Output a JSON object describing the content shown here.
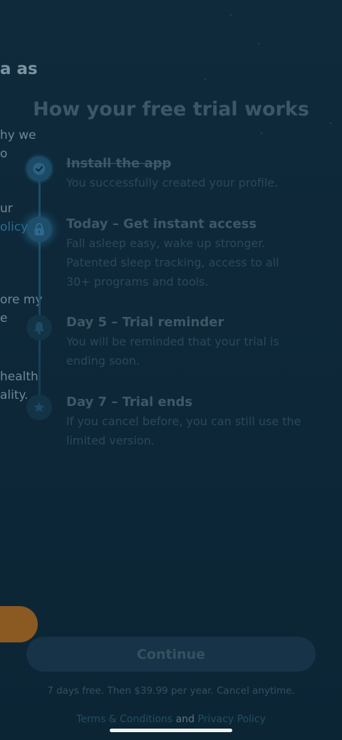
{
  "background_page": {
    "title_fragment": "a as",
    "lines": [
      "hy we",
      "o",
      "ur",
      "olicy",
      "ore my",
      "e",
      "health",
      "ality."
    ]
  },
  "heading": "How your free trial works",
  "steps": [
    {
      "icon": "check-icon",
      "title": "Install the app",
      "description": "You successfully created your profile.",
      "state": "completed"
    },
    {
      "icon": "lock-icon",
      "title": "Today – Get instant access",
      "description": "Fall asleep easy, wake up stronger. Patented sleep tracking, access to all 30+ programs and tools.",
      "state": "active"
    },
    {
      "icon": "bell-icon",
      "title": "Day 5 – Trial reminder",
      "description": "You will be reminded that your trial is ending soon.",
      "state": "upcoming"
    },
    {
      "icon": "star-icon",
      "title": "Day 7 – Trial ends",
      "description": "If you cancel before, you can still use the limited version.",
      "state": "upcoming"
    }
  ],
  "continue_label": "Continue",
  "pricing_text": "7 days free. Then $39.99 per year. Cancel anytime.",
  "footer": {
    "terms": "Terms & Conditions",
    "and": "and",
    "privacy": "Privacy Policy"
  },
  "colors": {
    "background": "#0d2637",
    "accent": "#1e4e6a",
    "orange": "#8a5a22"
  }
}
